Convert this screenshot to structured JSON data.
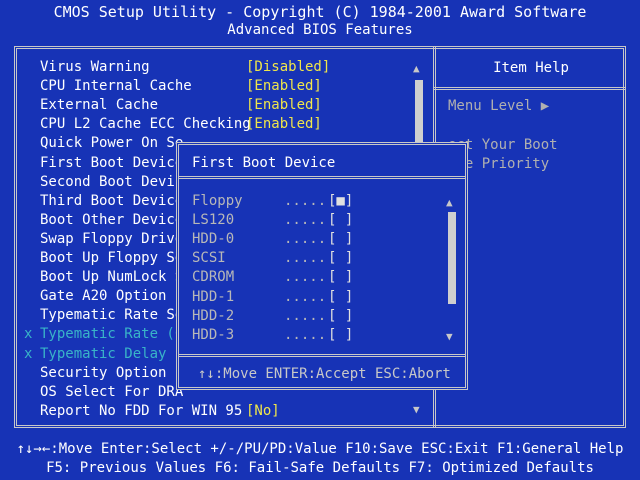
{
  "header": {
    "title": "CMOS Setup Utility - Copyright (C) 1984-2001 Award Software",
    "subtitle": "Advanced BIOS Features"
  },
  "settings": [
    {
      "label": "Virus Warning",
      "value": "[Disabled]"
    },
    {
      "label": "CPU Internal Cache",
      "value": "[Enabled]"
    },
    {
      "label": "External Cache",
      "value": "[Enabled]"
    },
    {
      "label": "CPU L2 Cache ECC Checking",
      "value": "[Enabled]"
    },
    {
      "label": "Quick Power On Se",
      "value": ""
    },
    {
      "label": "First Boot Device",
      "value": ""
    },
    {
      "label": "Second Boot Devic",
      "value": ""
    },
    {
      "label": "Third Boot Device",
      "value": ""
    },
    {
      "label": "Boot Other Device",
      "value": ""
    },
    {
      "label": "Swap Floppy Drive",
      "value": ""
    },
    {
      "label": "Boot Up Floppy Se",
      "value": ""
    },
    {
      "label": "Boot Up NumLock S",
      "value": ""
    },
    {
      "label": "Gate A20 Option",
      "value": ""
    },
    {
      "label": "Typematic Rate Se",
      "value": ""
    },
    {
      "label": "Typematic Rate (C",
      "value": "",
      "disabled": true
    },
    {
      "label": "Typematic Delay (",
      "value": "",
      "disabled": true
    },
    {
      "label": "Security Option",
      "value": ""
    },
    {
      "label": "OS Select For DRA",
      "value": ""
    },
    {
      "label": "Report No FDD For WIN 95",
      "value": "[No]"
    }
  ],
  "disabled_mark": "x",
  "scroll": {
    "up": "▲",
    "down": "▼"
  },
  "help": {
    "title": "Item Help",
    "menu_level": "Menu Level  ▶",
    "text_line1": "ect Your Boot",
    "text_line2": "ice Priority"
  },
  "popup": {
    "title": "First Boot Device",
    "items": [
      {
        "name": "Floppy",
        "dots": ".....",
        "box": "[■]"
      },
      {
        "name": "LS120",
        "dots": ".....",
        "box": "[ ]"
      },
      {
        "name": "HDD-0",
        "dots": ".....",
        "box": "[ ]"
      },
      {
        "name": "SCSI",
        "dots": ".....",
        "box": "[ ]"
      },
      {
        "name": "CDROM",
        "dots": ".....",
        "box": "[ ]"
      },
      {
        "name": "HDD-1",
        "dots": ".....",
        "box": "[ ]"
      },
      {
        "name": "HDD-2",
        "dots": ".....",
        "box": "[ ]"
      },
      {
        "name": "HDD-3",
        "dots": ".....",
        "box": "[ ]"
      }
    ],
    "footer": "↑↓:Move ENTER:Accept ESC:Abort"
  },
  "footer": {
    "line1": "↑↓→←:Move  Enter:Select  +/-/PU/PD:Value  F10:Save  ESC:Exit  F1:General Help",
    "line2": "F5: Previous Values     F6: Fail-Safe Defaults     F7: Optimized Defaults"
  },
  "colors": {
    "background": "#1733b6",
    "value": "#f0e64a",
    "disabled": "#39b4c8",
    "frame": "#c8c8c8"
  }
}
